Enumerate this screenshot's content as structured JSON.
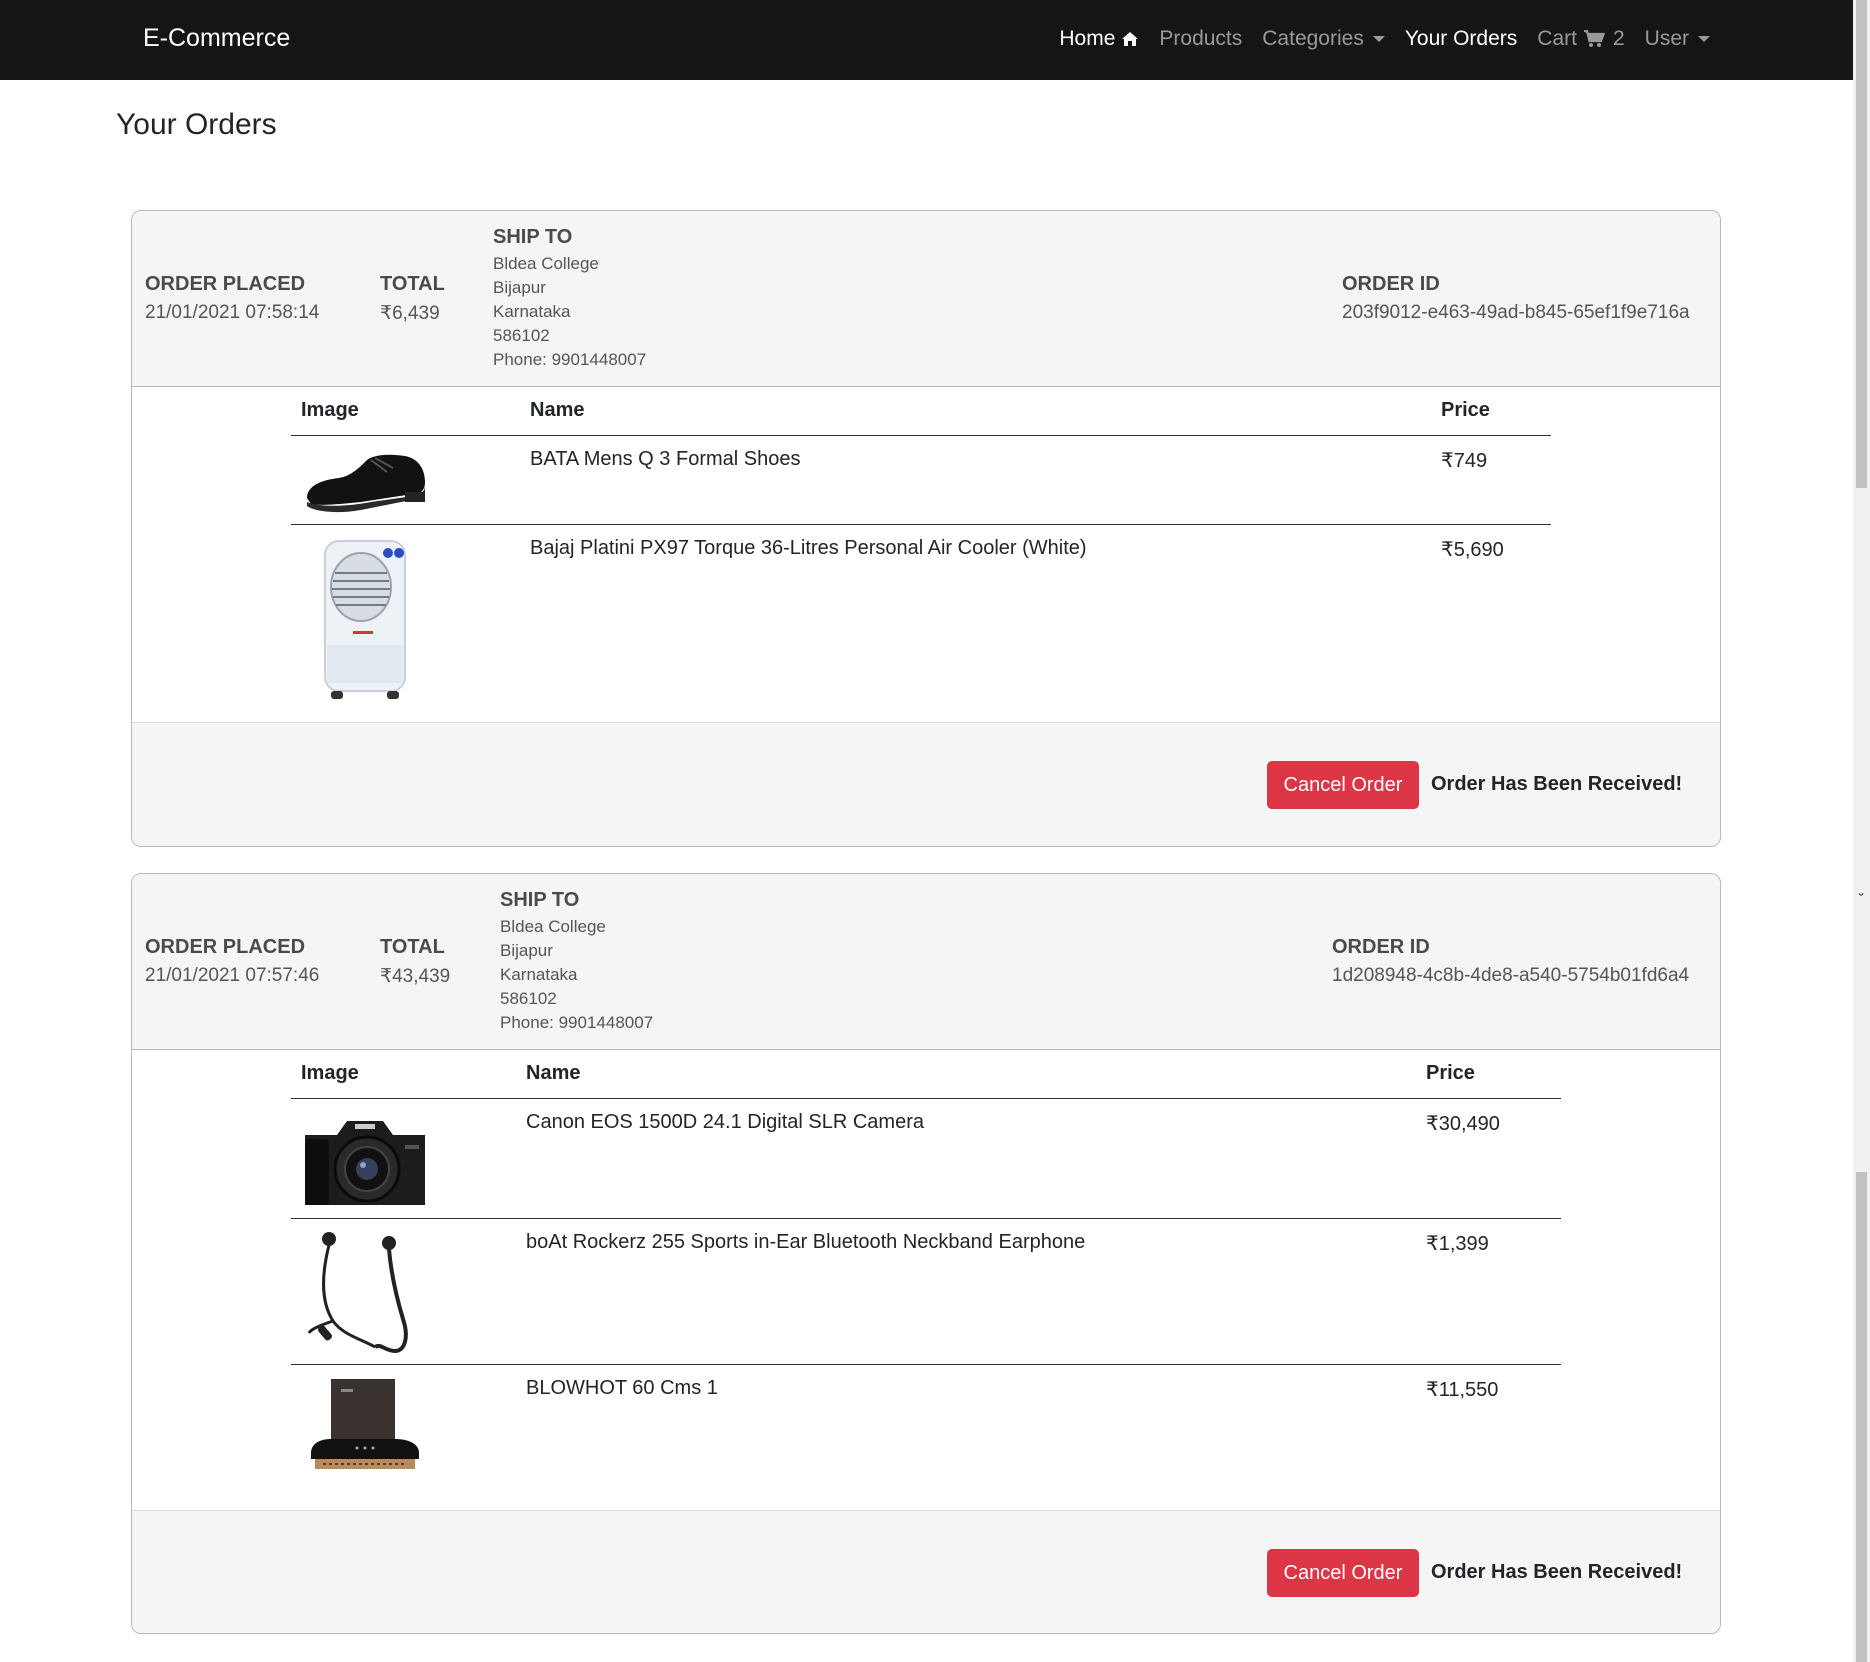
{
  "navbar": {
    "brand": "E-Commerce",
    "home": "Home",
    "products": "Products",
    "categories": "Categories",
    "your_orders": "Your Orders",
    "cart": "Cart",
    "cart_count": "2",
    "user": "User"
  },
  "page": {
    "title": "Your Orders"
  },
  "labels": {
    "order_placed": "ORDER PLACED",
    "total": "TOTAL",
    "ship_to": "SHIP TO",
    "order_id": "ORDER ID",
    "col_image": "Image",
    "col_name": "Name",
    "col_price": "Price",
    "cancel": "Cancel Order",
    "status": "Order Has Been Received!"
  },
  "orders": [
    {
      "placed": "21/01/2021 07:58:14",
      "total": "₹6,439",
      "ship": {
        "line1": "Bldea College",
        "line2": "Bijapur",
        "line3": "Karnataka",
        "line4": "586102",
        "phone": "Phone: 9901448007"
      },
      "id": "203f9012-e463-49ad-b845-65ef1f9e716a",
      "items": [
        {
          "name": "BATA Mens Q 3 Formal Shoes",
          "price": "₹749",
          "icon": "formal-shoe"
        },
        {
          "name": "Bajaj Platini PX97 Torque 36-Litres Personal Air Cooler (White)",
          "price": "₹5,690",
          "icon": "air-cooler"
        }
      ]
    },
    {
      "placed": "21/01/2021 07:57:46",
      "total": "₹43,439",
      "ship": {
        "line1": "Bldea College",
        "line2": "Bijapur",
        "line3": "Karnataka",
        "line4": "586102",
        "phone": "Phone: 9901448007"
      },
      "id": "1d208948-4c8b-4de8-a540-5754b01fd6a4",
      "items": [
        {
          "name": "Canon EOS 1500D 24.1 Digital SLR Camera",
          "price": "₹30,490",
          "icon": "dslr-camera"
        },
        {
          "name": "boAt Rockerz 255 Sports in-Ear Bluetooth Neckband Earphone",
          "price": "₹1,399",
          "icon": "neckband-earphone"
        },
        {
          "name": "BLOWHOT 60 Cms 1",
          "price": "₹11,550",
          "icon": "chimney-hood"
        }
      ]
    }
  ]
}
